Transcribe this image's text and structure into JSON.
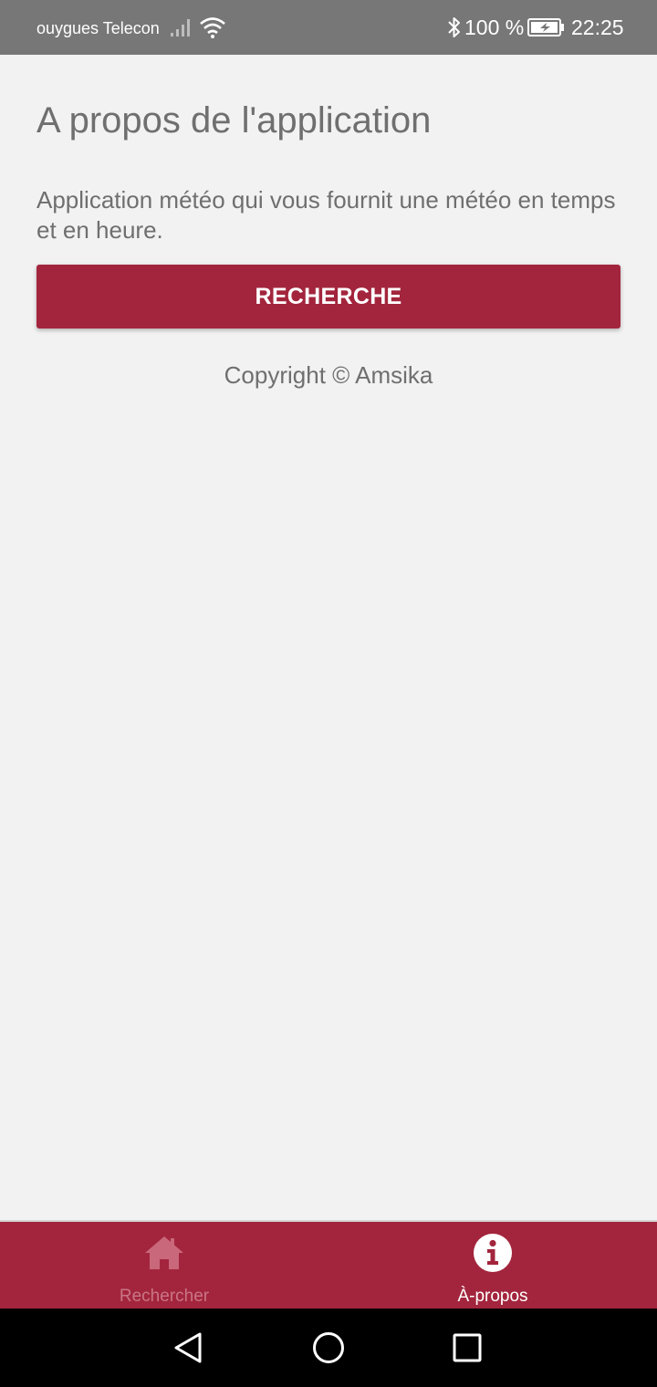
{
  "status_bar": {
    "carrier": "ouygues Telecon",
    "battery": "100 %",
    "time": "22:25",
    "icons": [
      "signal-icon",
      "wifi-icon",
      "bluetooth-icon",
      "battery-charging-icon"
    ]
  },
  "page": {
    "title": "A propos de l'application",
    "description": "Application météo qui vous fournit une météo en temps et en heure.",
    "button_label": "RECHERCHE",
    "copyright": "Copyright © Amsika"
  },
  "tab_bar": {
    "tabs": [
      {
        "label": "Rechercher",
        "icon": "home-icon",
        "active": false
      },
      {
        "label": "À-propos",
        "icon": "info-icon",
        "active": true
      }
    ]
  },
  "system_nav": {
    "buttons": [
      "back-icon",
      "home-circle-icon",
      "recent-apps-icon"
    ]
  },
  "colors": {
    "accent": "#a3253d",
    "status_bar": "#777777",
    "background": "#f2f2f2",
    "text": "#6f6f6f"
  }
}
